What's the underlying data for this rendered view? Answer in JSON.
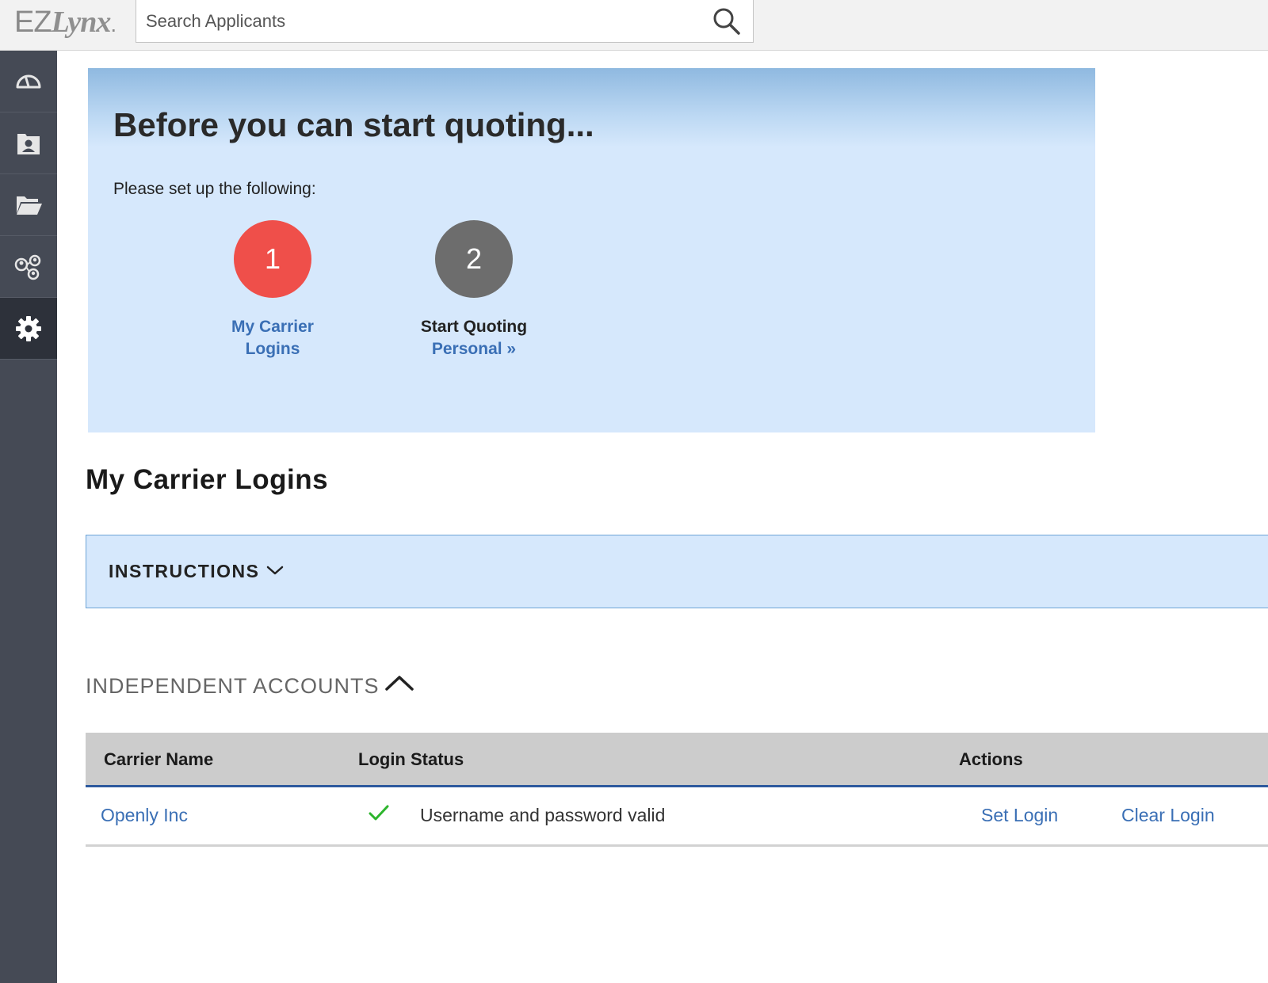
{
  "header": {
    "logo_prefix": "EZ",
    "logo_brand": "Lynx",
    "logo_suffix": ".",
    "search_placeholder": "Search Applicants"
  },
  "sidebar": {
    "items": [
      {
        "icon": "dashboard-icon"
      },
      {
        "icon": "contact-card-icon"
      },
      {
        "icon": "folder-icon"
      },
      {
        "icon": "users-group-icon"
      },
      {
        "icon": "gear-icon",
        "active": true
      }
    ]
  },
  "setup_banner": {
    "title": "Before you can start quoting...",
    "subtitle": "Please set up the following:",
    "steps": [
      {
        "number": "1",
        "line1": "My Carrier",
        "line2": "Logins",
        "color": "#ef4f4a"
      },
      {
        "number": "2",
        "line1": "Start Quoting",
        "line2": "Personal »",
        "color": "#6d6d6d"
      }
    ]
  },
  "main": {
    "section_title": "My Carrier Logins",
    "instructions_label": "INSTRUCTIONS",
    "accounts_header": "INDEPENDENT ACCOUNTS"
  },
  "table": {
    "columns": [
      "Carrier Name",
      "Login Status",
      "Actions"
    ],
    "rows": [
      {
        "carrier": "Openly Inc",
        "status": "Username and password valid",
        "action_set": "Set Login",
        "action_clear": "Clear Login"
      }
    ]
  },
  "colors": {
    "sidebar_bg": "#454a55",
    "link": "#3a6fb5",
    "banner_bg": "#d6e8fc",
    "step1": "#ef4f4a",
    "step2": "#6d6d6d",
    "valid_check": "#2db52d"
  }
}
